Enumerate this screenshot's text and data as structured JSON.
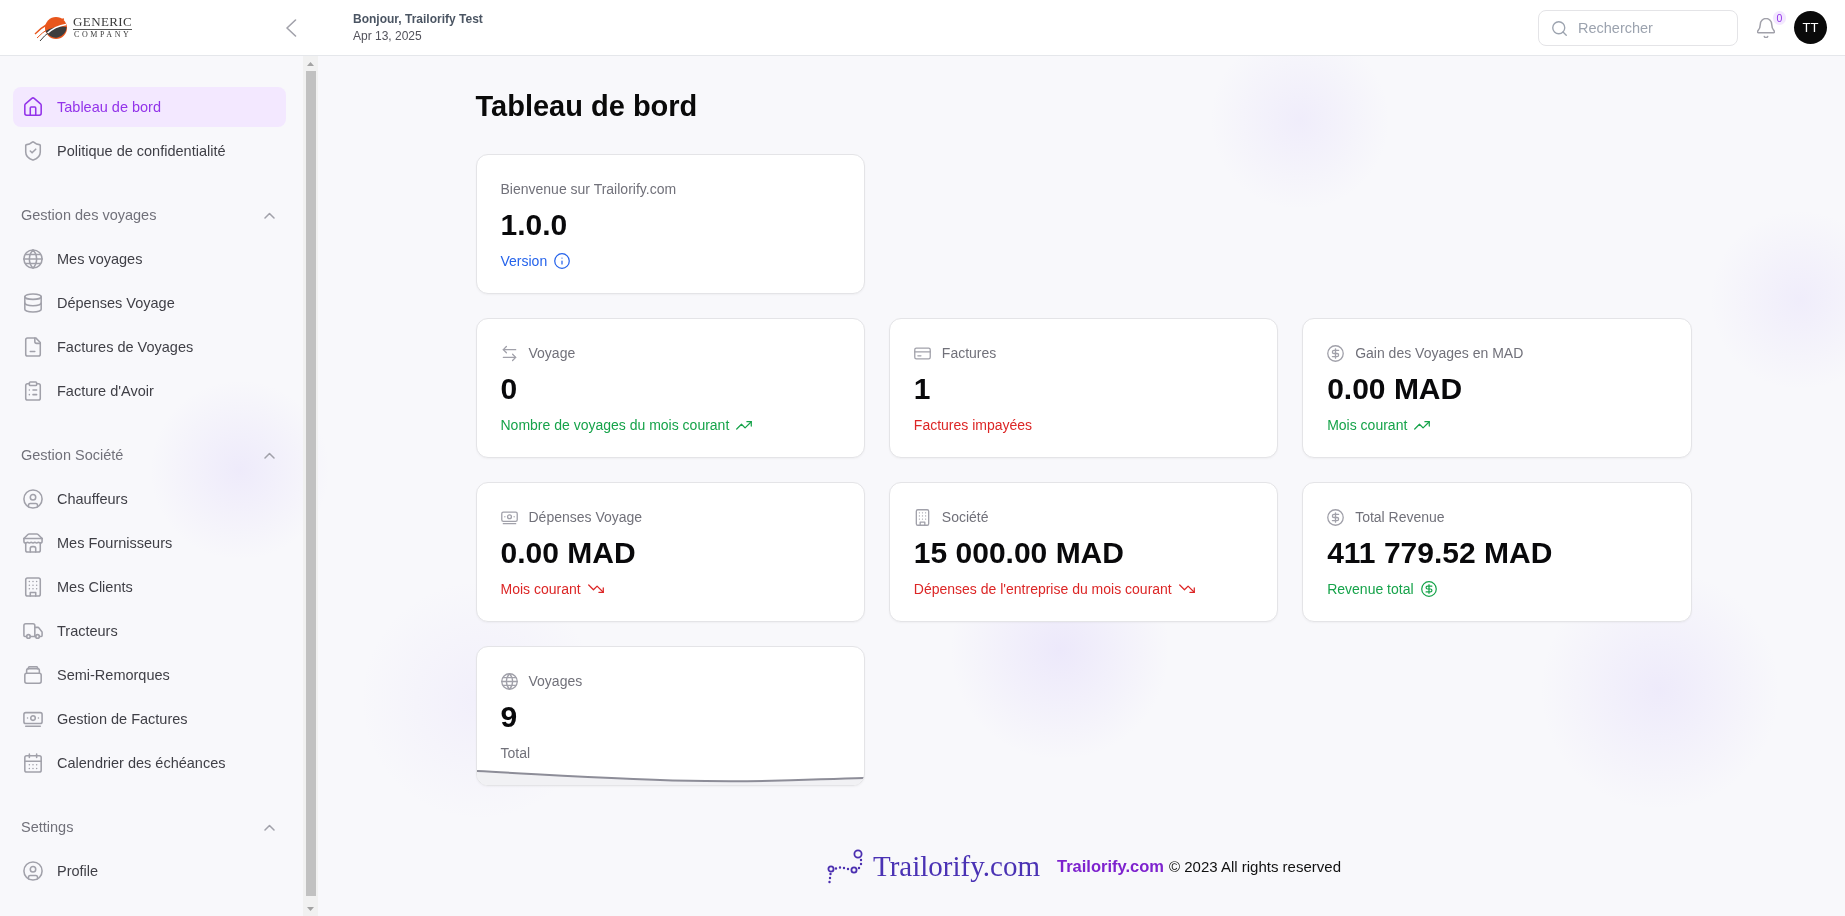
{
  "header": {
    "logo": {
      "line_1": "GENERIC",
      "line_2": "COMPANY"
    },
    "greeting": "Bonjour, Trailorify Test",
    "date": "Apr 13, 2025",
    "search": {
      "placeholder": "Rechercher"
    },
    "notification_count": "0",
    "avatar": "TT"
  },
  "sidebar": {
    "items": [
      {
        "label": "Tableau de bord",
        "selected": true
      },
      {
        "label": "Politique de confidentialité",
        "selected": false
      }
    ],
    "sections": [
      {
        "title": "Gestion des voyages",
        "expanded": true,
        "items": [
          {
            "label": "Mes voyages",
            "selected": false
          },
          {
            "label": "Dépenses Voyage",
            "selected": false
          },
          {
            "label": "Factures de Voyages",
            "selected": false
          },
          {
            "label": "Facture d'Avoir",
            "selected": false
          }
        ]
      },
      {
        "title": "Gestion Société",
        "expanded": true,
        "items": [
          {
            "label": "Chauffeurs",
            "selected": false
          },
          {
            "label": "Mes Fournisseurs",
            "selected": false
          },
          {
            "label": "Mes Clients",
            "selected": false
          },
          {
            "label": "Tracteurs",
            "selected": false
          },
          {
            "label": "Semi-Remorques",
            "selected": false
          },
          {
            "label": "Gestion de Factures",
            "selected": false
          },
          {
            "label": "Calendrier des échéances",
            "selected": false
          }
        ]
      },
      {
        "title": "Settings",
        "expanded": true,
        "items": [
          {
            "label": "Profile",
            "selected": false
          }
        ]
      }
    ]
  },
  "page": {
    "title": "Tableau de bord"
  },
  "card_rows": [
    [
      {
        "kind": "stat",
        "label": "Bienvenue sur Trailorify.com",
        "value": "1.0.0",
        "note": {
          "text": "Version",
          "color": "#2563eb"
        }
      }
    ],
    [
      {
        "kind": "stat",
        "label": "Voyage",
        "value": "0",
        "note": {
          "text": "Nombre de voyages du mois courant",
          "color": "#16a34a"
        }
      },
      {
        "kind": "stat",
        "label": "Factures",
        "value": "1",
        "note": {
          "text": "Factures impayées",
          "color": "#dc2626"
        }
      },
      {
        "kind": "stat",
        "label": "Gain des Voyages en MAD",
        "value": "0.00 MAD",
        "note": {
          "text": "Mois courant",
          "color": "#16a34a"
        }
      }
    ],
    [
      {
        "kind": "stat",
        "label": "Dépenses Voyage",
        "value": "0.00 MAD",
        "note": {
          "text": "Mois courant",
          "color": "#dc2626"
        }
      },
      {
        "kind": "stat",
        "label": "Société",
        "value": "15 000.00 MAD",
        "note": {
          "text": "Dépenses de l'entreprise du mois courant",
          "color": "#dc2626"
        }
      },
      {
        "kind": "stat",
        "label": "Total Revenue",
        "value": "411 779.52 MAD",
        "note": {
          "text": "Revenue total",
          "color": "#16a34a"
        }
      }
    ],
    [
      {
        "kind": "sparkline",
        "label": "Voyages",
        "value": "9",
        "note": {
          "text": "Total",
          "color": "#71717a"
        }
      }
    ]
  ],
  "footer": {
    "brand": "Trailorify.com",
    "link": "Trailorify.com",
    "copyright": "© 2023 All rights reserved"
  }
}
